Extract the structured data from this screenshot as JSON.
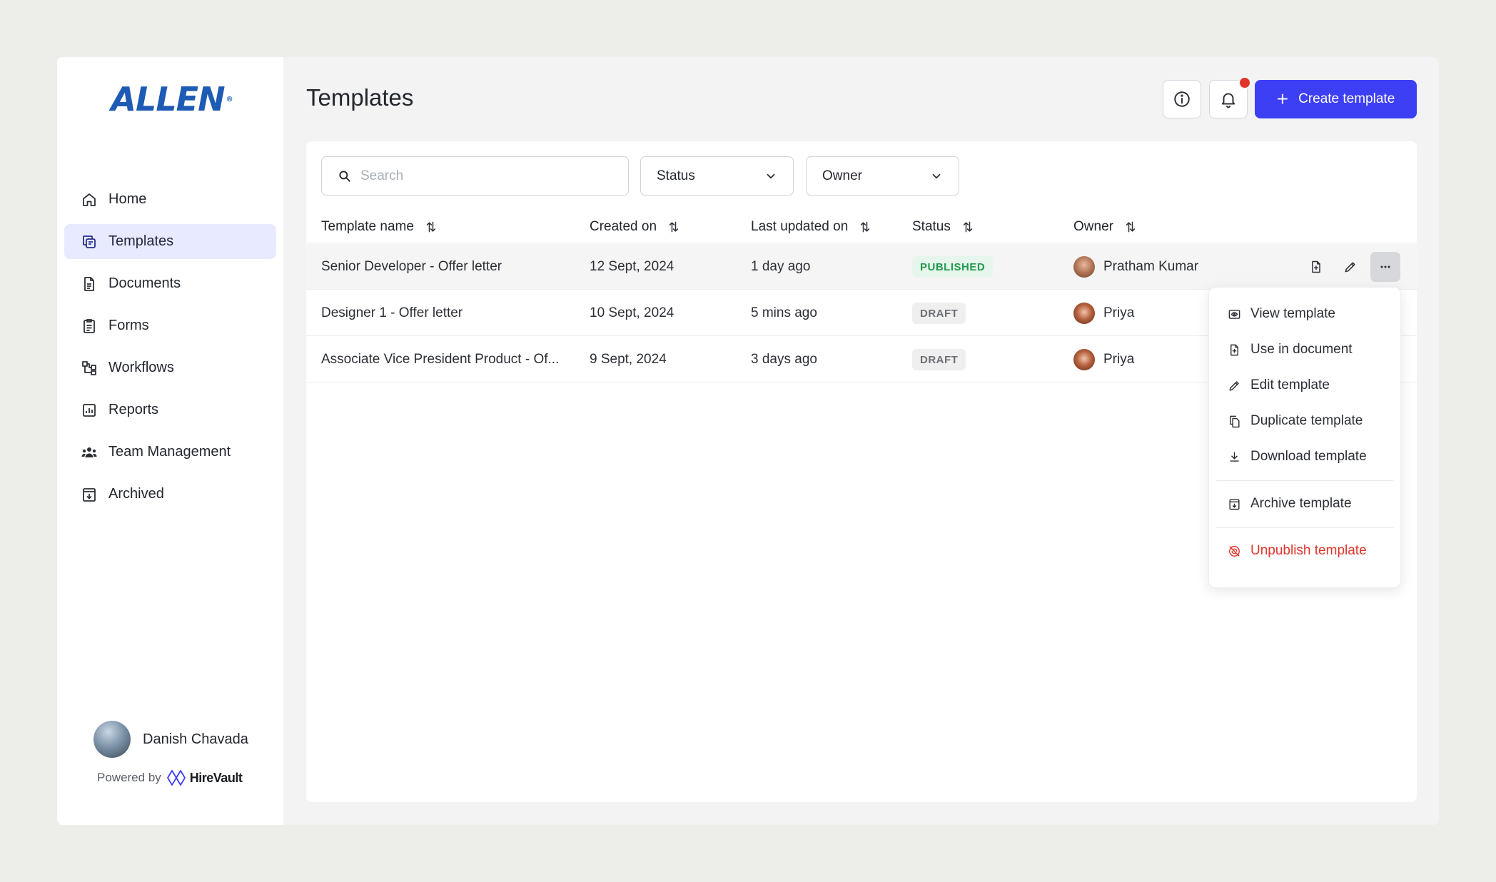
{
  "brand": {
    "logo_text": "ALLEN",
    "logo_mark": "®",
    "accent": "#3d3ff5",
    "logo_color": "#1e5bb5"
  },
  "sidebar": {
    "items": [
      {
        "label": "Home",
        "icon": "home-icon",
        "active": false
      },
      {
        "label": "Templates",
        "icon": "templates-icon",
        "active": true
      },
      {
        "label": "Documents",
        "icon": "document-icon",
        "active": false
      },
      {
        "label": "Forms",
        "icon": "forms-icon",
        "active": false
      },
      {
        "label": "Workflows",
        "icon": "workflow-icon",
        "active": false
      },
      {
        "label": "Reports",
        "icon": "reports-icon",
        "active": false
      },
      {
        "label": "Team Management",
        "icon": "team-icon",
        "active": false
      },
      {
        "label": "Archived",
        "icon": "archive-icon",
        "active": false
      }
    ],
    "user": {
      "name": "Danish Chavada"
    },
    "powered": {
      "prefix": "Powered by",
      "name": "HireVault"
    }
  },
  "header": {
    "title": "Templates",
    "create_label": "Create template",
    "info_icon": "info-icon",
    "bell_icon": "bell-icon"
  },
  "filters": {
    "search_placeholder": "Search",
    "status_label": "Status",
    "owner_label": "Owner"
  },
  "table": {
    "columns": [
      "Template name",
      "Created on",
      "Last updated on",
      "Status",
      "Owner"
    ],
    "rows": [
      {
        "name": "Senior Developer - Offer letter",
        "created": "12 Sept, 2024",
        "updated": "1 day ago",
        "status": "PUBLISHED",
        "owner": "Pratham Kumar"
      },
      {
        "name": "Designer 1 - Offer letter",
        "created": "10 Sept, 2024",
        "updated": "5 mins ago",
        "status": "DRAFT",
        "owner": "Priya"
      },
      {
        "name": "Associate Vice President Product - Of...",
        "created": "9 Sept, 2024",
        "updated": "3 days ago",
        "status": "DRAFT",
        "owner": "Priya"
      }
    ]
  },
  "context_menu": {
    "items": [
      {
        "label": "View template",
        "icon": "eye-icon"
      },
      {
        "label": "Use in document",
        "icon": "file-add-icon"
      },
      {
        "label": "Edit template",
        "icon": "pencil-icon"
      },
      {
        "label": "Duplicate template",
        "icon": "duplicate-icon"
      },
      {
        "label": "Download template",
        "icon": "download-icon"
      },
      {
        "label": "Archive template",
        "icon": "archive-icon"
      },
      {
        "label": "Unpublish template",
        "icon": "unpublish-icon"
      }
    ]
  }
}
